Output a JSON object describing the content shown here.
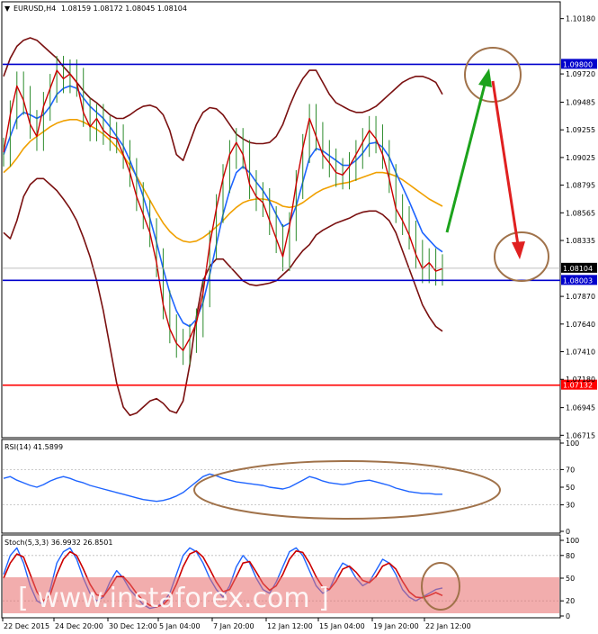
{
  "chart_data": [
    {
      "type": "line",
      "symbol": "EURUSD,H4",
      "ohlc_text": "1.08159 1.08172 1.08045 1.08104",
      "ylim": [
        1.0671,
        1.102
      ],
      "y_ticks": [
        "1.10180",
        "1.09720",
        "1.09485",
        "1.09255",
        "1.09025",
        "1.08795",
        "1.08565",
        "1.08335",
        "1.07870",
        "1.07640",
        "1.07410",
        "1.07180",
        "1.06945",
        "1.06715"
      ],
      "x_ticks": [
        "22 Dec 2015",
        "24 Dec 20:00",
        "30 Dec 12:00",
        "5 Jan 04:00",
        "7 Jan 20:00",
        "12 Jan 12:00",
        "15 Jan 04:00",
        "19 Jan 20:00",
        "22 Jan 12:00"
      ],
      "levels": [
        {
          "value": 1.098,
          "label": "1.09800",
          "color": "#0000cc"
        },
        {
          "value": 1.08003,
          "label": "1.08003",
          "color": "#0000cc"
        },
        {
          "value": 1.07132,
          "label": "1.07132",
          "color": "#ff0000"
        }
      ],
      "current_price": {
        "value": 1.08104,
        "label": "1.08104"
      },
      "close_series": [
        1.0907,
        1.0938,
        1.0962,
        1.095,
        1.093,
        1.092,
        1.0945,
        1.096,
        1.0975,
        1.0968,
        1.0972,
        1.0965,
        1.094,
        1.0928,
        1.0935,
        1.0925,
        1.092,
        1.0918,
        1.0905,
        1.089,
        1.087,
        1.0855,
        1.084,
        1.0815,
        1.078,
        1.076,
        1.0748,
        1.0742,
        1.0752,
        1.0765,
        1.079,
        1.083,
        1.086,
        1.0885,
        1.0905,
        1.0915,
        1.0905,
        1.088,
        1.087,
        1.0865,
        1.085,
        1.0835,
        1.082,
        1.0845,
        1.088,
        1.091,
        1.0935,
        1.092,
        1.0905,
        1.0898,
        1.089,
        1.0888,
        1.0895,
        1.0905,
        1.0915,
        1.0925,
        1.0918,
        1.0905,
        1.0885,
        1.086,
        1.085,
        1.0838,
        1.0822,
        1.081,
        1.0815,
        1.0808,
        1.081
      ],
      "ma_fast": [
        1.0905,
        1.092,
        1.0935,
        1.094,
        1.0938,
        1.0935,
        1.0938,
        1.0945,
        1.0955,
        1.096,
        1.0962,
        1.096,
        1.0952,
        1.0945,
        1.094,
        1.0935,
        1.0928,
        1.092,
        1.0912,
        1.09,
        1.0886,
        1.087,
        1.0852,
        1.0832,
        1.081,
        1.079,
        1.0775,
        1.0765,
        1.0762,
        1.0768,
        1.0782,
        1.0805,
        1.083,
        1.0855,
        1.0875,
        1.089,
        1.0895,
        1.089,
        1.0882,
        1.0875,
        1.0866,
        1.0855,
        1.0845,
        1.0848,
        1.0862,
        1.0882,
        1.0902,
        1.091,
        1.0908,
        1.0904,
        1.09,
        1.0896,
        1.0896,
        1.09,
        1.0906,
        1.0914,
        1.0915,
        1.0911,
        1.0903,
        1.089,
        1.0878,
        1.0866,
        1.0853,
        1.084,
        1.0834,
        1.0828,
        1.0824
      ],
      "ma_slow": [
        1.089,
        1.0895,
        1.0902,
        1.091,
        1.0916,
        1.092,
        1.0924,
        1.0928,
        1.0931,
        1.0933,
        1.0934,
        1.0934,
        1.0932,
        1.0929,
        1.0926,
        1.0922,
        1.0917,
        1.0911,
        1.0904,
        1.0896,
        1.0887,
        1.0877,
        1.0867,
        1.0857,
        1.0848,
        1.0841,
        1.0836,
        1.0833,
        1.0832,
        1.0833,
        1.0836,
        1.084,
        1.0845,
        1.085,
        1.0856,
        1.0861,
        1.0865,
        1.0867,
        1.0868,
        1.0868,
        1.0867,
        1.0865,
        1.0862,
        1.0861,
        1.0862,
        1.0865,
        1.0869,
        1.0873,
        1.0876,
        1.0878,
        1.088,
        1.0881,
        1.0882,
        1.0884,
        1.0886,
        1.0888,
        1.089,
        1.089,
        1.0889,
        1.0887,
        1.0884,
        1.088,
        1.0876,
        1.0872,
        1.0868,
        1.0865,
        1.0862
      ],
      "bb_upper": [
        1.097,
        1.0985,
        1.0995,
        1.1,
        1.1002,
        1.1,
        1.0995,
        1.099,
        1.0985,
        1.0978,
        1.0972,
        1.0965,
        1.0958,
        1.0952,
        1.0948,
        1.0943,
        1.0938,
        1.0935,
        1.0935,
        1.0938,
        1.0942,
        1.0945,
        1.0946,
        1.0944,
        1.0938,
        1.0925,
        1.0905,
        1.09,
        1.0915,
        1.093,
        1.094,
        1.0944,
        1.0943,
        1.0938,
        1.093,
        1.0922,
        1.0918,
        1.0915,
        1.0914,
        1.0914,
        1.0915,
        1.092,
        1.093,
        1.0945,
        1.0958,
        1.0968,
        1.0975,
        1.0975,
        1.0965,
        1.0955,
        1.0948,
        1.0945,
        1.0942,
        1.094,
        1.094,
        1.0942,
        1.0945,
        1.095,
        1.0955,
        1.096,
        1.0965,
        1.0968,
        1.097,
        1.097,
        1.0968,
        1.0965,
        1.0955
      ],
      "bb_lower": [
        1.084,
        1.0835,
        1.085,
        1.087,
        1.088,
        1.0885,
        1.0885,
        1.088,
        1.0875,
        1.0868,
        1.086,
        1.085,
        1.0836,
        1.082,
        1.08,
        1.0775,
        1.0745,
        1.0715,
        1.0695,
        1.0688,
        1.069,
        1.0695,
        1.07,
        1.0702,
        1.0698,
        1.0692,
        1.069,
        1.07,
        1.073,
        1.077,
        1.08,
        1.0812,
        1.0818,
        1.0818,
        1.0812,
        1.0806,
        1.08,
        1.0797,
        1.0796,
        1.0797,
        1.0798,
        1.08,
        1.0805,
        1.081,
        1.0818,
        1.0825,
        1.083,
        1.0838,
        1.0842,
        1.0845,
        1.0848,
        1.085,
        1.0852,
        1.0855,
        1.0857,
        1.0858,
        1.0858,
        1.0855,
        1.085,
        1.084,
        1.0825,
        1.081,
        1.0795,
        1.078,
        1.077,
        1.0762,
        1.0758
      ]
    },
    {
      "type": "line",
      "title": "RSI(14) 41.5899",
      "ylim": [
        0,
        100
      ],
      "y_ticks": [
        "100",
        "70",
        "50",
        "30",
        "0"
      ],
      "values": [
        60,
        62,
        58,
        55,
        52,
        50,
        53,
        57,
        60,
        62,
        60,
        57,
        55,
        52,
        50,
        48,
        46,
        44,
        42,
        40,
        38,
        36,
        35,
        34,
        35,
        37,
        40,
        44,
        50,
        56,
        62,
        65,
        63,
        60,
        58,
        56,
        55,
        54,
        53,
        52,
        50,
        49,
        48,
        50,
        54,
        58,
        62,
        60,
        57,
        55,
        54,
        53,
        54,
        56,
        57,
        58,
        56,
        54,
        52,
        49,
        47,
        45,
        44,
        43,
        43,
        42,
        42
      ]
    },
    {
      "type": "line",
      "title": "Stoch(5,3,3) 36.9932 26.8501",
      "ylim": [
        0,
        100
      ],
      "y_ticks": [
        "100",
        "80",
        "50",
        "20",
        "0"
      ],
      "series": [
        {
          "values": [
            55,
            80,
            90,
            70,
            40,
            20,
            15,
            35,
            70,
            85,
            90,
            75,
            50,
            30,
            20,
            25,
            45,
            60,
            50,
            35,
            25,
            15,
            10,
            12,
            18,
            30,
            55,
            80,
            90,
            85,
            70,
            50,
            35,
            25,
            40,
            65,
            80,
            70,
            50,
            35,
            30,
            45,
            65,
            85,
            90,
            80,
            60,
            40,
            30,
            35,
            55,
            70,
            65,
            50,
            40,
            45,
            60,
            75,
            70,
            55,
            35,
            25,
            20,
            25,
            30,
            35,
            37
          ]
        },
        {
          "values": [
            50,
            70,
            82,
            78,
            55,
            32,
            20,
            28,
            55,
            75,
            85,
            80,
            62,
            42,
            28,
            26,
            38,
            52,
            52,
            42,
            30,
            20,
            14,
            12,
            15,
            24,
            42,
            65,
            82,
            86,
            78,
            62,
            45,
            32,
            35,
            52,
            70,
            72,
            58,
            43,
            34,
            40,
            55,
            75,
            86,
            84,
            70,
            52,
            38,
            35,
            46,
            62,
            66,
            58,
            47,
            44,
            52,
            66,
            70,
            62,
            46,
            32,
            25,
            24,
            27,
            31,
            27
          ]
        }
      ]
    }
  ],
  "annotations": {
    "watermark": "[ www.instaforex.com ]",
    "up_arrow_color": "#1ca31c",
    "down_arrow_color": "#e02020",
    "circle_color": "#a0724a",
    "upper_band_color": "#7a1010",
    "fast_ma_color": "#1e64ff",
    "slow_ma_color": "#f0a000",
    "price_color": "#cc0000"
  }
}
